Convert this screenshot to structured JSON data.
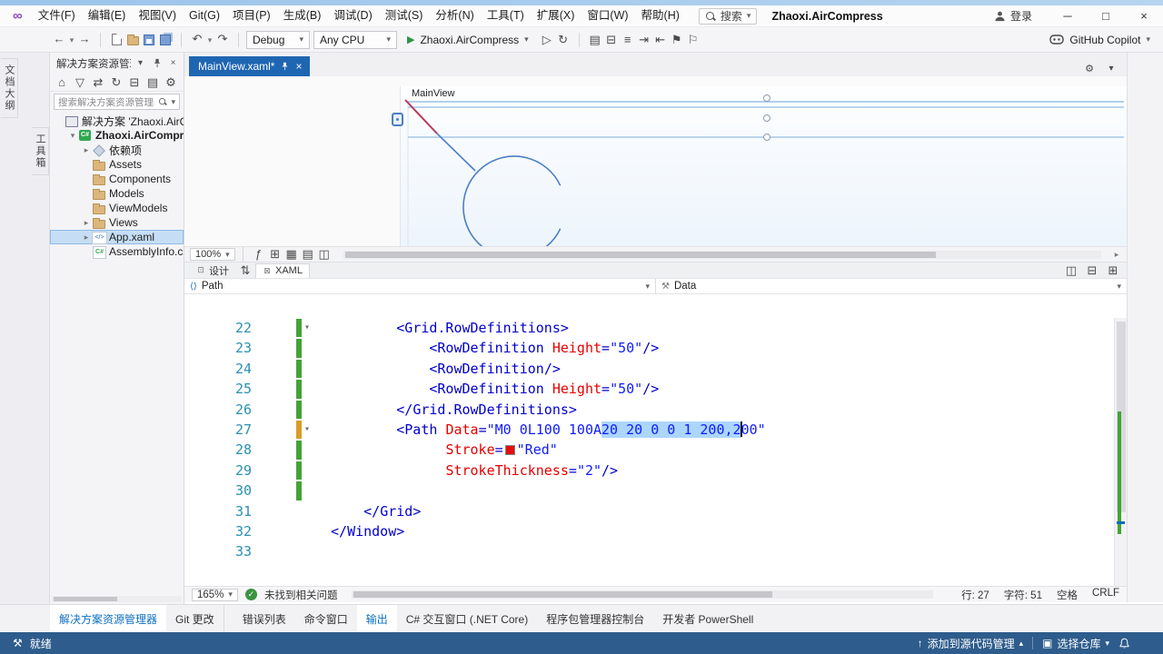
{
  "titlebar": {
    "menus": [
      "文件(F)",
      "编辑(E)",
      "视图(V)",
      "Git(G)",
      "项目(P)",
      "生成(B)",
      "调试(D)",
      "测试(S)",
      "分析(N)",
      "工具(T)",
      "扩展(X)",
      "窗口(W)",
      "帮助(H)"
    ],
    "search": "搜索",
    "title": "Zhaoxi.AirCompress",
    "signin": "登录"
  },
  "toolbar": {
    "config": "Debug",
    "platform": "Any CPU",
    "run": "Zhaoxi.AirCompress",
    "copilot": "GitHub Copilot",
    "icons_nav": [
      {
        "name": "back-icon",
        "g": "←"
      },
      {
        "name": "back-dropdown-icon",
        "g": "▾"
      },
      {
        "name": "forward-icon",
        "g": "→"
      }
    ],
    "icons_file": [
      {
        "name": "new-file-icon",
        "g": "css-newfile"
      },
      {
        "name": "open-folder-icon",
        "g": "css-folder"
      },
      {
        "name": "save-icon",
        "g": "css-save"
      },
      {
        "name": "save-all-icon",
        "g": "css-saveall"
      }
    ],
    "icons_undo": [
      {
        "name": "undo-icon",
        "g": "↶"
      },
      {
        "name": "undo-dropdown-icon",
        "g": "▾"
      },
      {
        "name": "redo-icon",
        "g": "↷"
      }
    ],
    "icons_run_extra": [
      {
        "name": "run-without-debug-icon",
        "g": "▷"
      },
      {
        "name": "hot-reload-icon",
        "g": "↻"
      }
    ],
    "icons_misc": [
      {
        "name": "profiler-icon",
        "g": "▤"
      },
      {
        "name": "breakpoint-window-icon",
        "g": "⊟"
      },
      {
        "name": "comment-icon",
        "g": "≡"
      },
      {
        "name": "indent-icon",
        "g": "⇥"
      },
      {
        "name": "outdent-icon",
        "g": "⇤"
      },
      {
        "name": "bookmark-icon",
        "g": "⚑"
      },
      {
        "name": "bookmark-list-icon",
        "g": "⚐"
      }
    ]
  },
  "rails": {
    "outline_tab": "文档大纲",
    "toolbox_tab": "工具箱"
  },
  "solution": {
    "header": "解决方案资源管理器",
    "toolbar_icons": [
      {
        "name": "home-icon",
        "g": "⌂"
      },
      {
        "name": "filter-icon",
        "g": "▽"
      },
      {
        "name": "sync-active-document-icon",
        "g": "⇄"
      },
      {
        "name": "refresh-icon",
        "g": "↻"
      },
      {
        "name": "collapse-all-icon",
        "g": "⊟"
      },
      {
        "name": "show-all-files-icon",
        "g": "▤"
      },
      {
        "name": "properties-icon",
        "g": "⚙"
      }
    ],
    "search_placeholder": "搜索解决方案资源管理器(Ctrl+;)",
    "tree": [
      {
        "label": "解决方案 'Zhaoxi.AirCompr",
        "icon": "solution",
        "level": 0
      },
      {
        "label": "Zhaoxi.AirCompress",
        "icon": "csproj",
        "level": 1,
        "arrow": "▾",
        "bold": true
      },
      {
        "label": "依赖项",
        "icon": "deps",
        "level": 2,
        "arrow": "▸"
      },
      {
        "label": "Assets",
        "icon": "folder",
        "level": 2
      },
      {
        "label": "Components",
        "icon": "folder",
        "level": 2
      },
      {
        "label": "Models",
        "icon": "folder",
        "level": 2
      },
      {
        "label": "ViewModels",
        "icon": "folder",
        "level": 2
      },
      {
        "label": "Views",
        "icon": "folder",
        "level": 2,
        "arrow": "▸"
      },
      {
        "label": "App.xaml",
        "icon": "xaml",
        "level": 2,
        "arrow": "▸",
        "selected": true
      },
      {
        "label": "AssemblyInfo.cs",
        "icon": "cs",
        "level": 2
      }
    ]
  },
  "editor": {
    "tab": "MainView.xaml*",
    "designer": {
      "title": "MainView",
      "zoom": "100%",
      "design_tab": "设计",
      "xaml_tab": "XAML",
      "toolbar_icons": [
        {
          "name": "effects-icon",
          "g": "ƒ"
        },
        {
          "name": "grid-icon",
          "g": "⊞"
        },
        {
          "name": "snap-grid-icon",
          "g": "▦"
        },
        {
          "name": "guides-icon",
          "g": "▤"
        },
        {
          "name": "snap-lines-icon",
          "g": "◫"
        }
      ],
      "split_icons": [
        {
          "name": "split-vertical-icon",
          "g": "◫"
        },
        {
          "name": "split-horizontal-icon",
          "g": "⊟"
        },
        {
          "name": "expand-pane-icon",
          "g": "⊞"
        }
      ]
    },
    "breadcrumb": {
      "left": "Path",
      "right": "Data"
    },
    "code": {
      "lines": [
        {
          "n": "22",
          "chev": true,
          "bar": "green",
          "tokens": [
            [
              "s",
              8
            ],
            [
              "d",
              "<"
            ],
            [
              "t",
              "Grid.RowDefinitions"
            ],
            [
              "d",
              ">"
            ]
          ]
        },
        {
          "n": "23",
          "bar": "green",
          "tokens": [
            [
              "s",
              12
            ],
            [
              "d",
              "<"
            ],
            [
              "t",
              "RowDefinition"
            ],
            [
              "s",
              1
            ],
            [
              "a",
              "Height"
            ],
            [
              "d",
              "="
            ],
            [
              "v",
              "\"50\""
            ],
            [
              "d",
              "/>"
            ]
          ]
        },
        {
          "n": "24",
          "bar": "green",
          "tokens": [
            [
              "s",
              12
            ],
            [
              "d",
              "<"
            ],
            [
              "t",
              "RowDefinition"
            ],
            [
              "d",
              "/>"
            ]
          ]
        },
        {
          "n": "25",
          "bar": "green",
          "tokens": [
            [
              "s",
              12
            ],
            [
              "d",
              "<"
            ],
            [
              "t",
              "RowDefinition"
            ],
            [
              "s",
              1
            ],
            [
              "a",
              "Height"
            ],
            [
              "d",
              "="
            ],
            [
              "v",
              "\"50\""
            ],
            [
              "d",
              "/>"
            ]
          ]
        },
        {
          "n": "26",
          "bar": "green",
          "tokens": [
            [
              "s",
              8
            ],
            [
              "d",
              "</"
            ],
            [
              "t",
              "Grid.RowDefinitions"
            ],
            [
              "d",
              ">"
            ]
          ]
        },
        {
          "n": "27",
          "chev": true,
          "bar": "yellow",
          "tokens": [
            [
              "s",
              8
            ],
            [
              "d",
              "<"
            ],
            [
              "t",
              "Path"
            ],
            [
              "s",
              1
            ],
            [
              "a",
              "Data"
            ],
            [
              "d",
              "="
            ],
            [
              "v",
              "\"M0 0L100 100A"
            ],
            [
              "x",
              "20 20 0 0 1 200,2"
            ],
            [
              "c",
              ""
            ],
            [
              "v",
              "00\""
            ]
          ]
        },
        {
          "n": "28",
          "bar": "green",
          "tokens": [
            [
              "s",
              14
            ],
            [
              "a",
              "Stroke"
            ],
            [
              "d",
              "="
            ],
            [
              "w",
              "#e01010"
            ],
            [
              "v",
              "\"Red\""
            ]
          ]
        },
        {
          "n": "29",
          "bar": "green",
          "tokens": [
            [
              "s",
              14
            ],
            [
              "a",
              "StrokeThickness"
            ],
            [
              "d",
              "="
            ],
            [
              "v",
              "\"2\""
            ],
            [
              "d",
              "/>"
            ]
          ]
        },
        {
          "n": "30",
          "bar": "green",
          "tokens": []
        },
        {
          "n": "31",
          "tokens": [
            [
              "s",
              4
            ],
            [
              "d",
              "</"
            ],
            [
              "t",
              "Grid"
            ],
            [
              "d",
              ">"
            ]
          ]
        },
        {
          "n": "32",
          "tokens": [
            [
              "d",
              "</"
            ],
            [
              "t",
              "Window"
            ],
            [
              "d",
              ">"
            ]
          ]
        },
        {
          "n": "33",
          "tokens": []
        }
      ]
    },
    "bottom": {
      "zoom": "165%",
      "health": "未找到相关问题",
      "line": "行: 27",
      "col": "字符: 51",
      "spaces": "空格",
      "eol": "CRLF"
    }
  },
  "panels": {
    "left_tabs": [
      "解决方案资源管理器",
      "Git 更改"
    ],
    "left_active": "解决方案资源管理器",
    "bottom_tabs": [
      "错误列表",
      "命令窗口",
      "输出",
      "C# 交互窗口 (.NET Core)",
      "程序包管理器控制台",
      "开发者 PowerShell"
    ],
    "bottom_active": "输出"
  },
  "statusbar": {
    "ready": "就绪",
    "scm": "添加到源代码管理",
    "repo": "选择仓库"
  }
}
